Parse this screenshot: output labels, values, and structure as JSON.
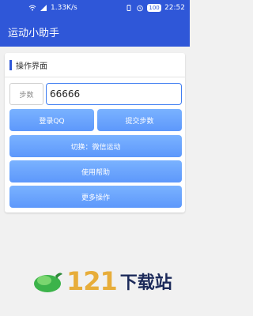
{
  "status_bar": {
    "network_speed": "1.33K/s",
    "battery": "100",
    "time": "22:52"
  },
  "app_bar": {
    "title": "运动小助手"
  },
  "panel": {
    "title": "操作界面",
    "steps_label": "步数",
    "steps_value": "66666"
  },
  "buttons": {
    "login": "登录QQ",
    "submit_steps": "提交步数",
    "switch": "切换：微信运动",
    "help": "使用帮助",
    "more": "更多操作"
  },
  "watermark": {
    "number": "121",
    "text": "下载站"
  },
  "colors": {
    "primary": "#2f57d8",
    "button": "#6aa4fd",
    "accent": "#3f7df1"
  }
}
